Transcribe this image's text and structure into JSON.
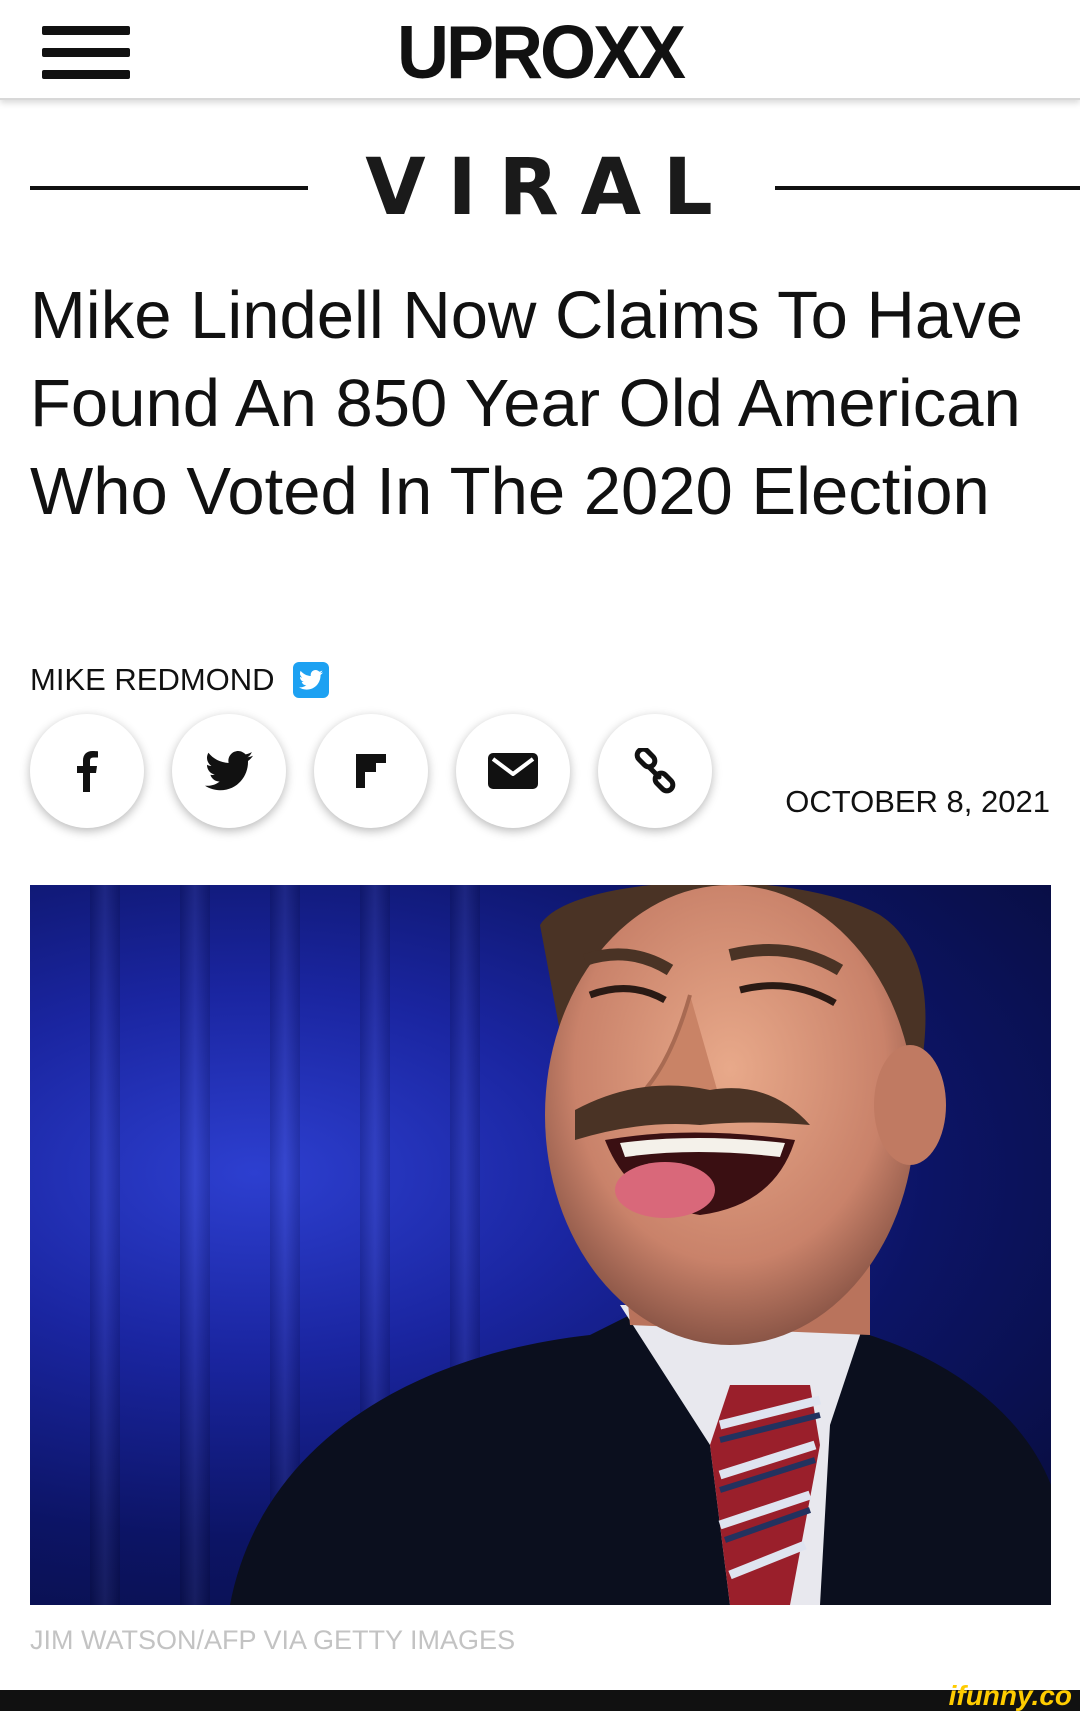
{
  "header": {
    "logo": "UPROXX",
    "menu_icon": "hamburger-menu-icon"
  },
  "section": {
    "label": "VIRAL"
  },
  "article": {
    "headline": "Mike Lindell Now Claims To Have Found An 850 Year Old American Who Voted In The 2020 Election",
    "author": "MIKE REDMOND",
    "date": "OCTOBER 8, 2021",
    "photo_credit": "JIM WATSON/AFP VIA GETTY IMAGES"
  },
  "share_buttons": [
    {
      "icon": "facebook-icon"
    },
    {
      "icon": "twitter-icon"
    },
    {
      "icon": "flipboard-icon"
    },
    {
      "icon": "email-icon"
    },
    {
      "icon": "link-icon"
    }
  ],
  "watermark": "ifunny.co",
  "colors": {
    "twitter_blue": "#1da1f2",
    "curtain_blue": "#1a25a0",
    "watermark_yellow": "#ffcc00"
  }
}
